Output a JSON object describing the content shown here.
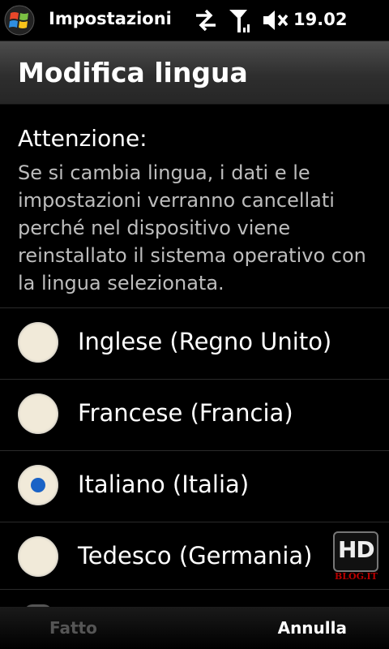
{
  "statusbar": {
    "app_title": "Impostazioni",
    "time": "19.02",
    "icons": [
      "windows-logo-icon",
      "data-sync-icon",
      "signal-icon",
      "volume-muted-icon"
    ]
  },
  "header": {
    "title": "Modifica lingua"
  },
  "warning": {
    "title": "Attenzione:",
    "text": "Se si cambia lingua, i dati e le impostazioni verranno cancellati perché nel dispositivo viene reinstallato il sistema operativo con la lingua selezionata."
  },
  "languages": [
    {
      "label": "Inglese (Regno Unito)",
      "selected": false
    },
    {
      "label": "Francese (Francia)",
      "selected": false
    },
    {
      "label": "Italiano (Italia)",
      "selected": true
    },
    {
      "label": "Tedesco (Germania)",
      "selected": false
    }
  ],
  "watermark": {
    "logo": "HD",
    "sub": "BLOG.IT"
  },
  "softkeys": {
    "left": "Fatto",
    "right": "Annulla"
  },
  "colors": {
    "accent": "#1a63c6",
    "radio_fill": "#f1ead9",
    "disabled_text": "#555555"
  }
}
